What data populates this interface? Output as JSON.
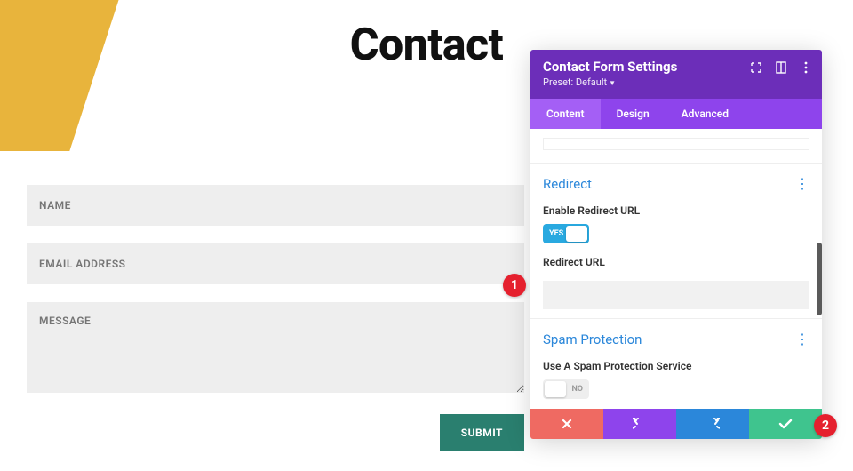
{
  "page": {
    "title": "Contact"
  },
  "form": {
    "name_placeholder": "NAME",
    "email_placeholder": "EMAIL ADDRESS",
    "message_placeholder": "MESSAGE",
    "submit_label": "SUBMIT"
  },
  "panel": {
    "title": "Contact Form Settings",
    "preset_label": "Preset: Default",
    "tabs": {
      "content": "Content",
      "design": "Design",
      "advanced": "Advanced",
      "active": "content"
    },
    "redirect": {
      "heading": "Redirect",
      "enable_label": "Enable Redirect URL",
      "enable_value": true,
      "enable_text": "YES",
      "url_label": "Redirect URL",
      "url_value": ""
    },
    "spam": {
      "heading": "Spam Protection",
      "service_label": "Use A Spam Protection Service",
      "service_value": false,
      "service_text": "NO"
    }
  },
  "annotations": {
    "badge1": "1",
    "badge2": "2"
  }
}
